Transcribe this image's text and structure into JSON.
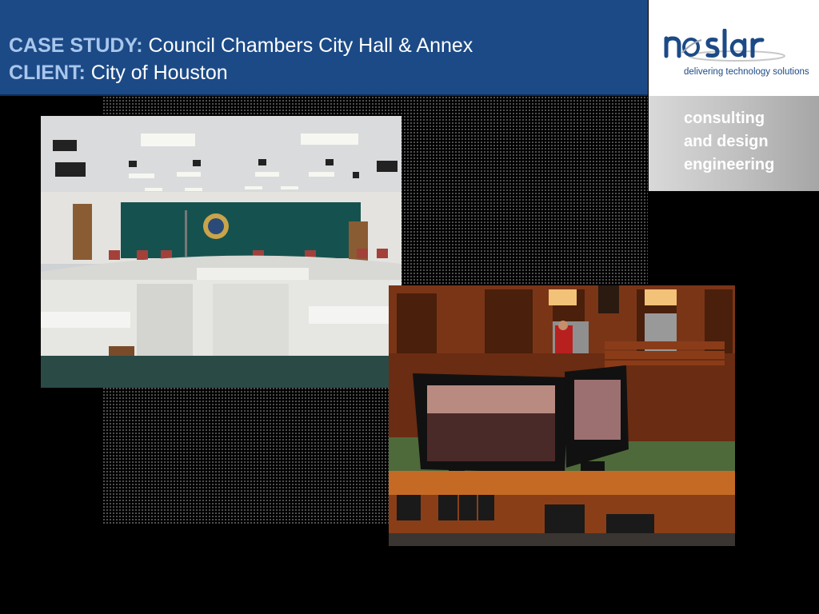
{
  "header": {
    "case_study_key": "CASE STUDY:",
    "case_study_value": " Council Chambers City Hall & Annex",
    "client_key": "CLIENT:",
    "client_value": " City of Houston"
  },
  "logo": {
    "wordmark": "noslar",
    "tagline": "delivering technology solutions"
  },
  "services": [
    "consulting",
    "and design",
    "engineering"
  ],
  "photos": [
    {
      "subject": "council chamber with curved dais"
    },
    {
      "subject": "courtroom with monitors and control panel"
    }
  ],
  "colors": {
    "header_bg": "#1c4a86",
    "header_key": "#a9c6ec",
    "logo_blue": "#1c4a86"
  }
}
